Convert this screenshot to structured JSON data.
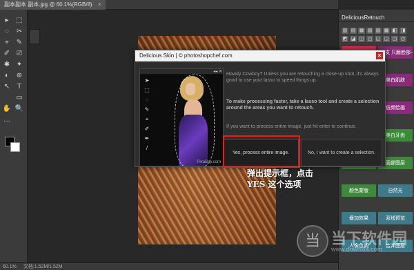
{
  "document_tab": {
    "title": "副本副本 副本.jpg @ 60.1%(RGB/8)",
    "close": "×"
  },
  "status": {
    "zoom": "60.1%",
    "doc_size": "文档:1.52M/1.52M"
  },
  "tools": [
    "▸",
    "⬚",
    "◌",
    "✂",
    "⌖",
    "✎",
    "✐",
    "⎚",
    "✱",
    "✦",
    "◐",
    "⊕",
    "T",
    "↖",
    "▭",
    "✋",
    "🔍",
    "…"
  ],
  "right_panel": {
    "title": "DeliciousRetouch",
    "icons": [
      "▥",
      "▤",
      "▦",
      "▧",
      "▨",
      "▩",
      "◧",
      "◨",
      "◩",
      "◪",
      "◫",
      "◰",
      "◱",
      "◲",
      "◳",
      "◴"
    ],
    "buttons": [
      {
        "label": "完美皮肤",
        "color": "#d6324f"
      },
      {
        "label": "一键磨皮 只磨脸部一次",
        "color": "#8a2b7a"
      },
      {
        "label": "皮肤抚平",
        "color": "#8a2b7a"
      },
      {
        "label": "美白肌肤",
        "color": "#8a2b7a"
      },
      {
        "label": "加深减淡",
        "color": "#8a2b7a"
      },
      {
        "label": "低频绘画",
        "color": "#8a2b7a"
      },
      {
        "label": "增强眼睛",
        "color": "#2a6b8a"
      },
      {
        "label": "美白牙齿",
        "color": "#3d8a3a"
      },
      {
        "label": "高级锐化",
        "color": "#3d8a3a"
      },
      {
        "label": "面部图层",
        "color": "#3d8a3a"
      },
      {
        "label": "颜色蒙版",
        "color": "#3d8a3a"
      },
      {
        "label": "自然光",
        "color": "#3d7a8a"
      },
      {
        "label": "叠加效果",
        "color": "#3d7a8a"
      },
      {
        "label": "双线预览",
        "color": "#3d7a8a"
      },
      {
        "label": "人像色调",
        "color": "#3d7a8a"
      },
      {
        "label": "合并图层",
        "color": "#3d7a8a"
      }
    ]
  },
  "dialog": {
    "title": "Delicious Skin | © photoshopchef.com",
    "close": "×",
    "preview_tab": "",
    "preview_credit": "PixaBay.com",
    "messages": [
      "Howdy Cowboy? Unless you are retouching a close-up shot, it's always good to use your lasso to speed things up.",
      "To make processing faster, take a lasso tool and create a selection around the areas you want to retouch.",
      "If you want to process entire image, just hit enter to continue."
    ],
    "btn_yes": "Yes, process entire image.",
    "btn_no": "No, I want to create a selection."
  },
  "annotation": {
    "line1": "弹出提示框，点击",
    "line2": "YES 这个选项"
  },
  "watermark": {
    "logo": "当",
    "text": "当下软件园",
    "url": "www.downxia.com"
  }
}
